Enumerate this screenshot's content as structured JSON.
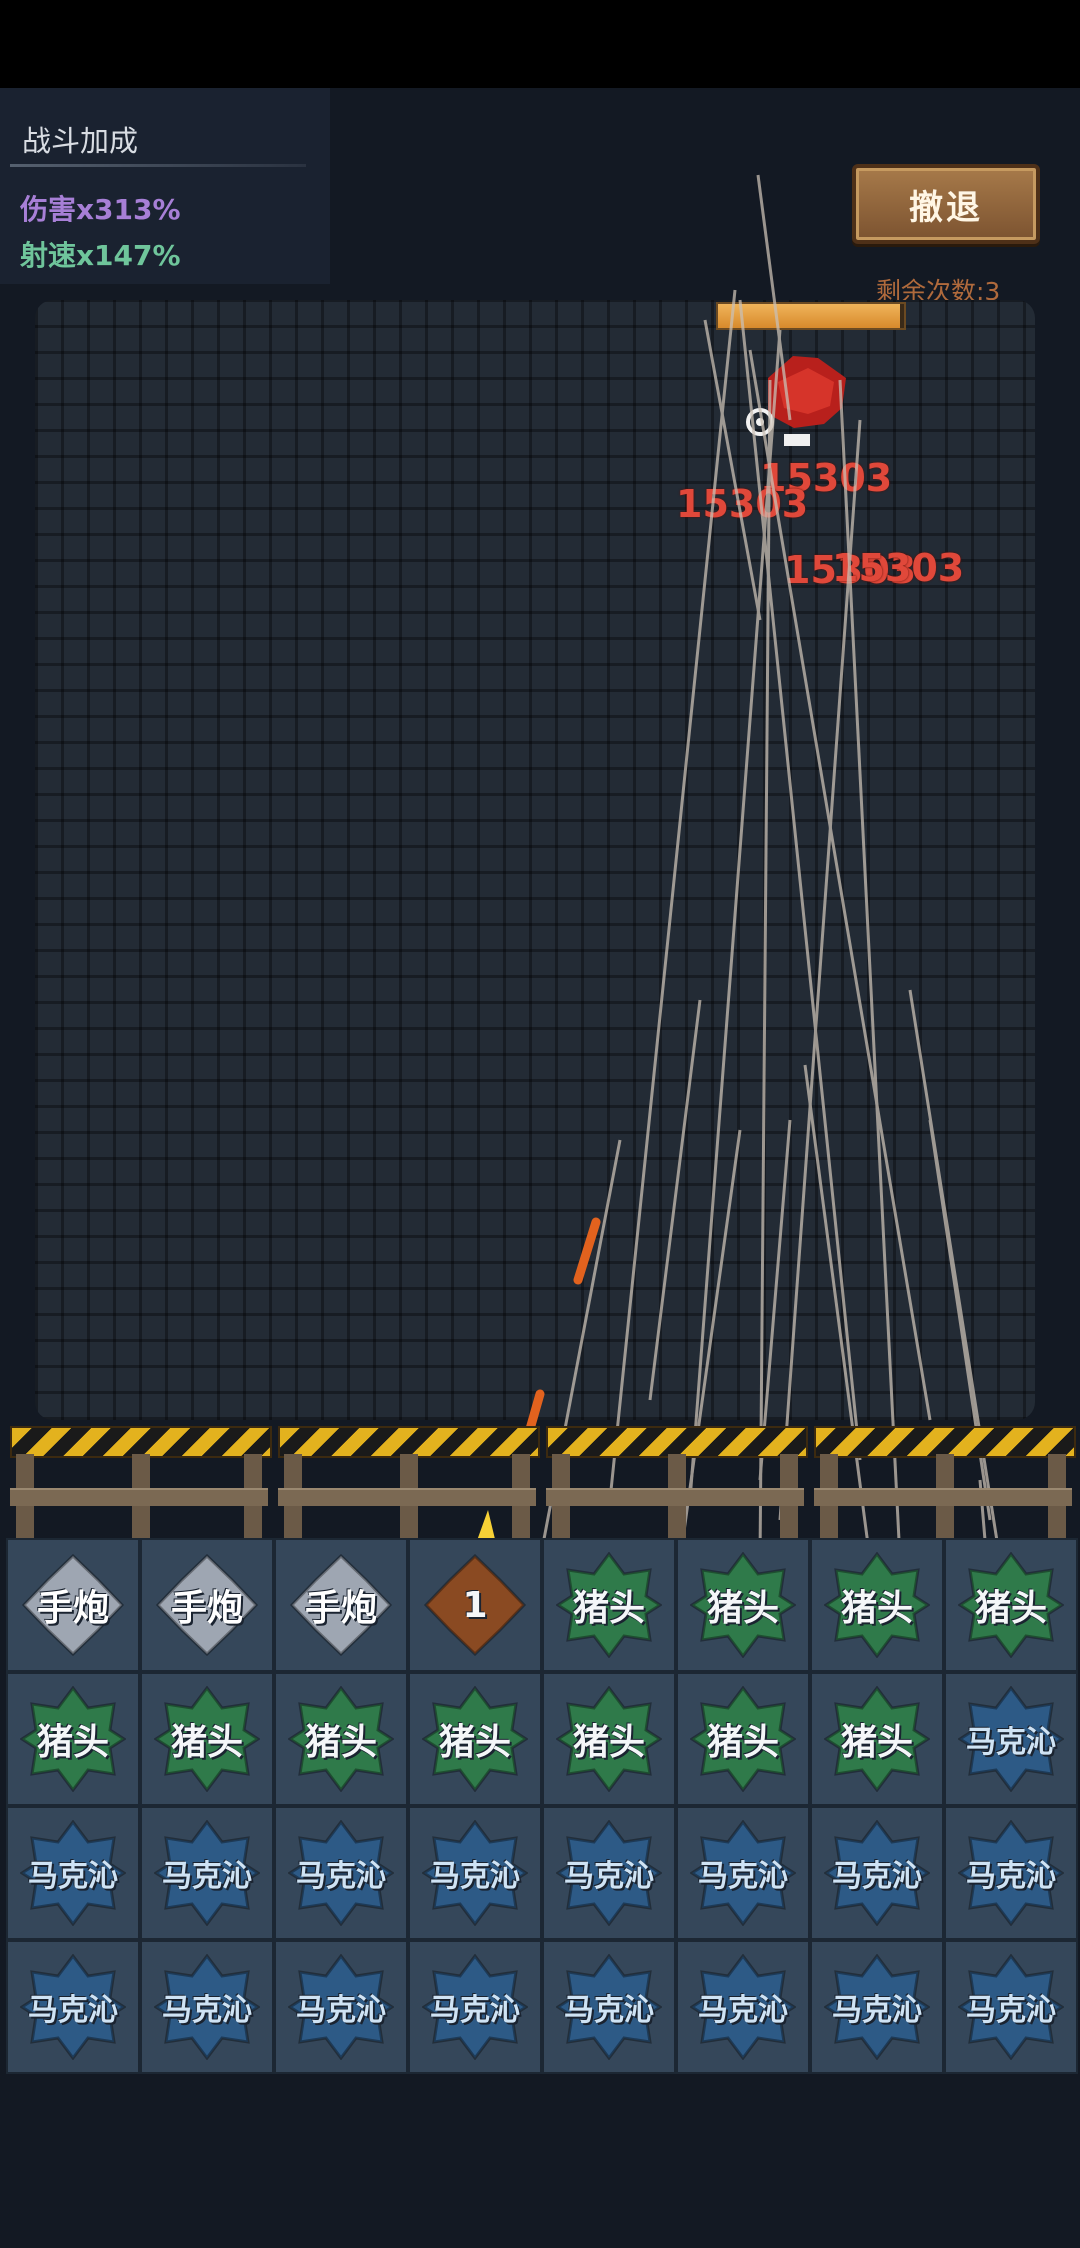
{
  "bonus": {
    "title": "战斗加成",
    "damage": "伤害x313%",
    "fire_rate": "射速x147%"
  },
  "retreat": {
    "label": "撤退",
    "remaining": "剩余次数:3"
  },
  "boss": {
    "hp_fraction": 0.98
  },
  "damage_numbers": [
    "15303",
    "15303",
    "15303",
    "15303"
  ],
  "grid": {
    "rows": [
      [
        "手炮",
        "手炮",
        "手炮",
        "1",
        "猪头",
        "猪头",
        "猪头",
        "猪头"
      ],
      [
        "猪头",
        "猪头",
        "猪头",
        "猪头",
        "猪头",
        "猪头",
        "猪头",
        "马克沁"
      ],
      [
        "马克沁",
        "马克沁",
        "马克沁",
        "马克沁",
        "马克沁",
        "马克沁",
        "马克沁",
        "马克沁"
      ],
      [
        "马克沁",
        "马克沁",
        "马克沁",
        "马克沁",
        "马克沁",
        "马克沁",
        "马克沁",
        "马克沁"
      ]
    ]
  },
  "colors": {
    "cannon": "#9ea6b2",
    "pighead": "#2f7a4a",
    "maxim": "#2d5a86",
    "fire_cell": "#8a4a22"
  }
}
